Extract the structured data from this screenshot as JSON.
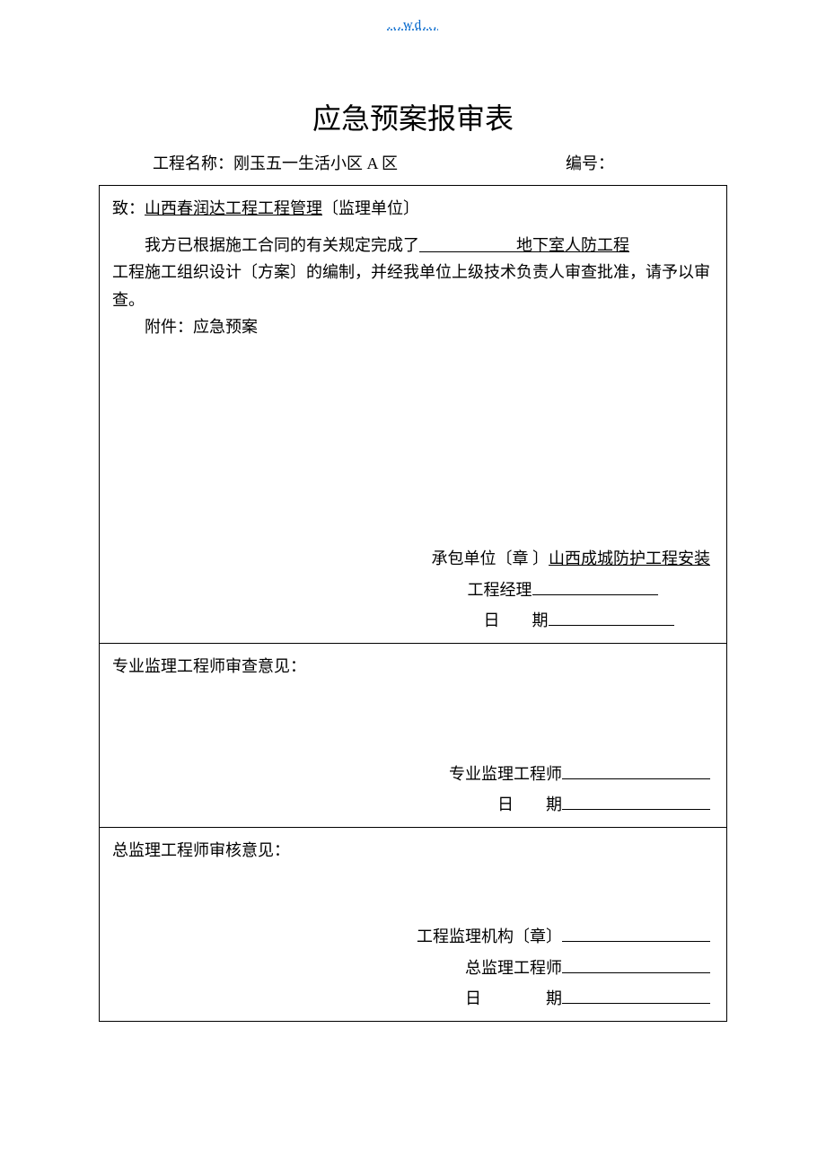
{
  "header": {
    "link_text": "...wd..."
  },
  "title": "应急预案报审表",
  "meta": {
    "project_label": "工程名称：",
    "project_name": "刚玉五一生活小区 A 区",
    "number_label": "编号："
  },
  "section1": {
    "to_label": "致：",
    "to_value": "山西春润达工程工程管理",
    "to_suffix": "〔监理单位〕",
    "body_prefix": "我方已根据施工合同的有关规定完成了",
    "body_blank": "　　　　　　",
    "body_project": "地下室人防工程",
    "body_line2": "工程施工组织设计〔方案〕的编制，并经我单位上级技术负责人审查批准，请予以审查。",
    "attachment_label": "附件：应急预案",
    "contractor_label": "承包单位〔章 〕",
    "contractor_value": "山西成城防护工程安装",
    "manager_label": "工程经理",
    "date_label": "日　　期"
  },
  "section2": {
    "heading": "专业监理工程师审查意见：",
    "engineer_label": "专业监理工程师",
    "date_label": "日　　期"
  },
  "section3": {
    "heading": "总监理工程师审核意见：",
    "org_label": "工程监理机构〔章〕",
    "chief_label": "总监理工程师",
    "date_label": "日　　　　期"
  }
}
